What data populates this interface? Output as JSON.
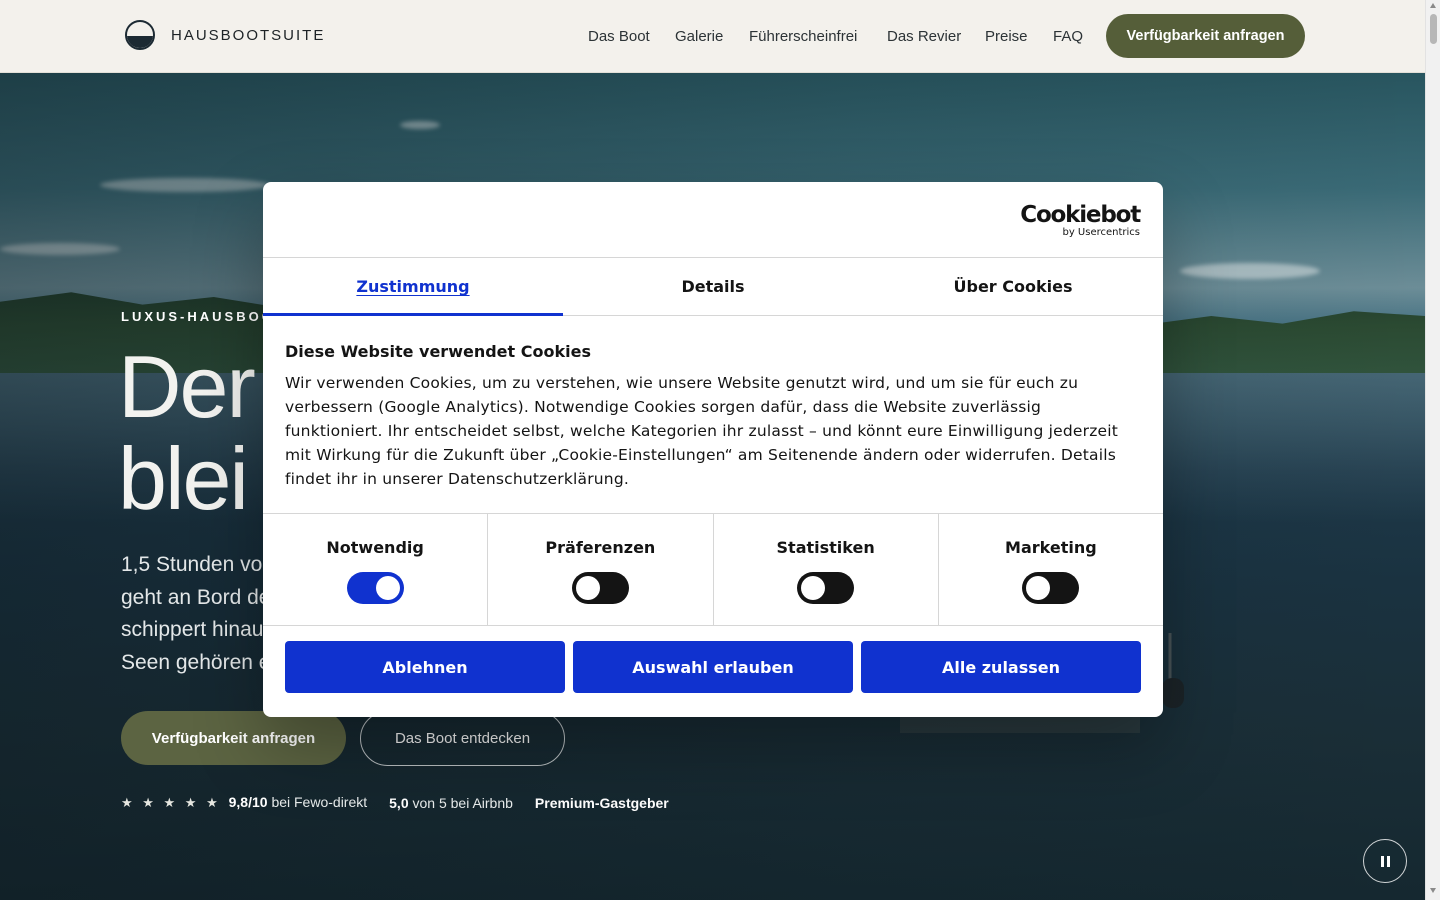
{
  "header": {
    "brand": "HAUSBOOTSUITE",
    "nav": [
      "Das Boot",
      "Galerie",
      "Führerscheinfrei",
      "Das Revier",
      "Preise",
      "FAQ"
    ],
    "cta": "Verfügbarkeit anfragen"
  },
  "hero": {
    "eyebrow": "LUXUS-HAUSBOOT",
    "headline": "Der\nblei",
    "subtext": "1,5 Stunden von\ngeht an Bord de\nschippert hinau\nSeen gehören e",
    "primary_button": "Verfügbarkeit anfragen",
    "secondary_button": "Das Boot entdecken",
    "ratings": [
      {
        "stars": "★ ★ ★ ★ ★",
        "score": "9,8/10",
        "text": "bei Fewo-direkt"
      },
      {
        "score": "5,0",
        "text": "von 5 bei Airbnb"
      },
      {
        "score": "Premium-Gastgeber",
        "text": ""
      }
    ]
  },
  "cookie_dialog": {
    "logo_text": "Cookiebot",
    "logo_subtext": "by Usercentrics",
    "tabs": [
      "Zustimmung",
      "Details",
      "Über Cookies"
    ],
    "active_tab": "Zustimmung",
    "title": "Diese Website verwendet Cookies",
    "body": "Wir verwenden Cookies, um zu verstehen, wie unsere Website genutzt wird, und um sie für euch zu verbessern (Google Analytics). Notwendige Cookies sorgen dafür, dass die Website zuverlässig funktioniert. Ihr entscheidet selbst, welche Kategorien ihr zulasst – und könnt eure Einwilligung jederzeit mit Wirkung für die Zukunft über „Cookie-Einstellungen“ am Seitenende ändern oder widerrufen. Details findet ihr in unserer Datenschutzerklärung.",
    "categories": [
      {
        "label": "Notwendig",
        "enabled": true
      },
      {
        "label": "Präferenzen",
        "enabled": false
      },
      {
        "label": "Statistiken",
        "enabled": false
      },
      {
        "label": "Marketing",
        "enabled": false
      }
    ],
    "buttons": {
      "reject": "Ablehnen",
      "allow_selection": "Auswahl erlauben",
      "allow_all": "Alle zulassen"
    }
  },
  "colors": {
    "accent": "#1032cf",
    "brand_olive": "#555e39",
    "header_bg": "#f3f1ec"
  },
  "icons": {
    "logo": "half-filled-circle-icon",
    "pause": "pause-icon"
  }
}
